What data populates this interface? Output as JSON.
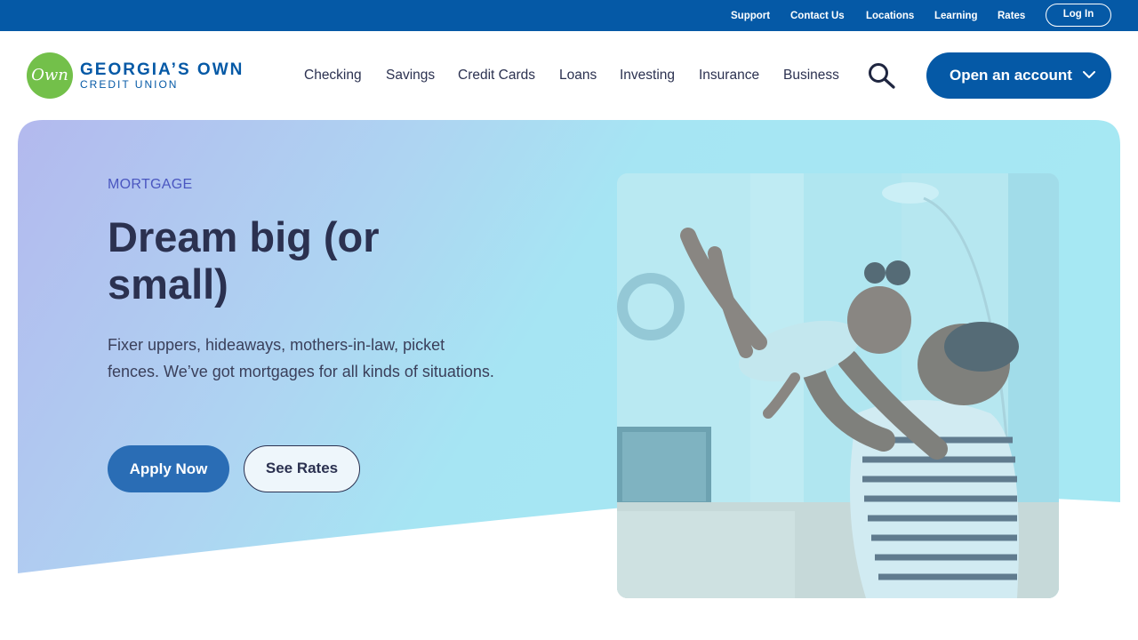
{
  "utility": {
    "links": [
      "Support",
      "Contact Us",
      "Locations",
      "Learning",
      "Rates"
    ],
    "login_label": "Log In"
  },
  "brand": {
    "mark": "Own",
    "name": "GEORGIA’S OWN",
    "sub": "CREDIT UNION",
    "colors": {
      "primary": "#0559a6",
      "mark": "#73c04a"
    }
  },
  "nav": {
    "items": [
      "Checking",
      "Savings",
      "Credit Cards",
      "Loans",
      "Investing",
      "Insurance",
      "Business"
    ],
    "search_icon": "search-icon",
    "cta_label": "Open an account"
  },
  "hero": {
    "eyebrow": "MORTGAGE",
    "headline": "Dream big (or small)",
    "body": "Fixer uppers, hideaways, mothers-in-law, picket fences. We’ve got mortgages for all kinds of situations.",
    "primary_cta": "Apply Now",
    "secondary_cta": "See Rates",
    "image": "photo of a father lifting a laughing child in a living room"
  }
}
